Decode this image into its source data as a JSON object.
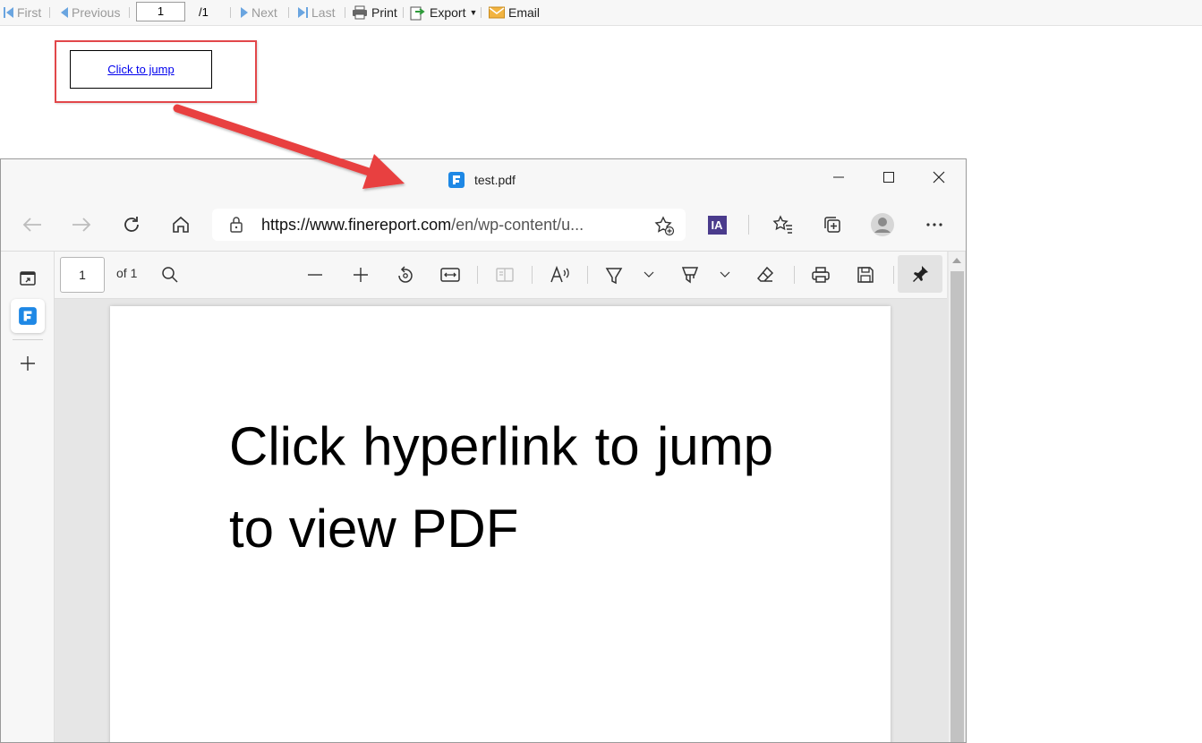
{
  "report_toolbar": {
    "first_label": "First",
    "previous_label": "Previous",
    "page_value": "1",
    "page_total": "/1",
    "next_label": "Next",
    "last_label": "Last",
    "print_label": "Print",
    "export_label": "Export",
    "email_label": "Email"
  },
  "report_cell": {
    "link_text": "Click to jump"
  },
  "browser": {
    "tab_title": "test.pdf",
    "address_url_domain": "https://www.finereport.com",
    "address_url_path": "/en/wp-content/u...",
    "extension_label": "IA",
    "pdf_toolbar": {
      "page_value": "1",
      "page_of": "of 1"
    },
    "pdf_page_text": "Click hyperlink to jump to view PDF"
  },
  "colors": {
    "highlight": "#e2474a",
    "toolbar_icon": "#6aa5e0",
    "link": "#0000ee",
    "brand_blue": "#1e88e5"
  }
}
